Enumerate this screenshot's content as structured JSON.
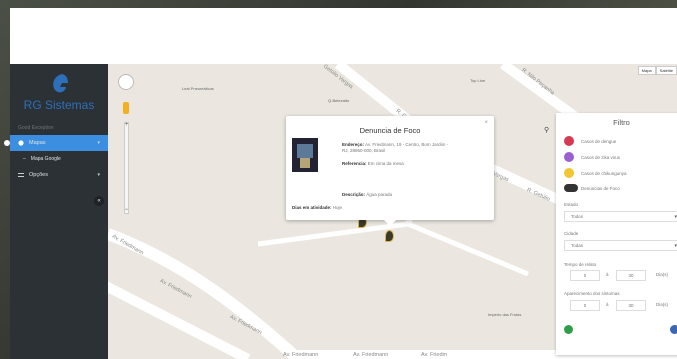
{
  "sidebar": {
    "brand": "RG Sistemas",
    "nav_header": "Good Exception",
    "items": [
      {
        "label": "Mapas",
        "caret": "▾"
      },
      {
        "label": "Mapa Google"
      },
      {
        "label": "Opções",
        "caret": "▾"
      }
    ],
    "collapse_glyph": "«"
  },
  "map": {
    "streets": [
      "Getúlio Vargas",
      "R. Gu",
      "Av. Friedmann",
      "R. Nilo Peçanha",
      "Vargas",
      "R. Getúlio",
      "Av. Friedmann",
      "Av. Friedmann",
      "Av. Friedmann",
      "Av. Friedmann",
      "Av. Friedm"
    ],
    "pois": [
      "Leal Pneumáticos",
      "Q-Belezatto",
      "Top Line",
      "Imperio das Frutas"
    ],
    "map_type": [
      "Mapa",
      "Satélite"
    ],
    "zoom_plus": "+",
    "zoom_minus": "−"
  },
  "popup": {
    "title": "Denuncia de Foco",
    "close": "×",
    "endereco_label": "Endereço:",
    "endereco_value": "Av. Friedmann, 19 - Centro, Bom Jardim -",
    "endereco_value2": "RJ, 28660-000, Brasil",
    "referencia_label": "Referencia:",
    "referencia_value": "Em cima da mesa",
    "descricao_label": "Descrição:",
    "descricao_value": "Água parada",
    "dias_label": "Dias em atividade:",
    "dias_value": "Hoje"
  },
  "filter": {
    "title": "Filtro",
    "layers": [
      {
        "label": "Casos de dengue",
        "color": "#d63a52"
      },
      {
        "label": "Casos de zika virus",
        "color": "#9b5fd0"
      },
      {
        "label": "Casos de chikungunya",
        "color": "#f2c531"
      },
      {
        "label": "Denuncias de Foco",
        "color": "#333333"
      }
    ],
    "estado_label": "Estado",
    "estado_value": "Todos",
    "cidade_label": "Cidade",
    "cidade_value": "Todas",
    "tempo_label": "Tempo de relato",
    "tempo_from": "0",
    "tempo_sep": "à",
    "tempo_to": "30",
    "tempo_unit": "Dia(s)",
    "sintomas_label": "Aparecimento dos sintomas",
    "sintomas_from": "0",
    "sintomas_sep": "à",
    "sintomas_to": "30",
    "sintomas_unit": "Dia(s)"
  }
}
